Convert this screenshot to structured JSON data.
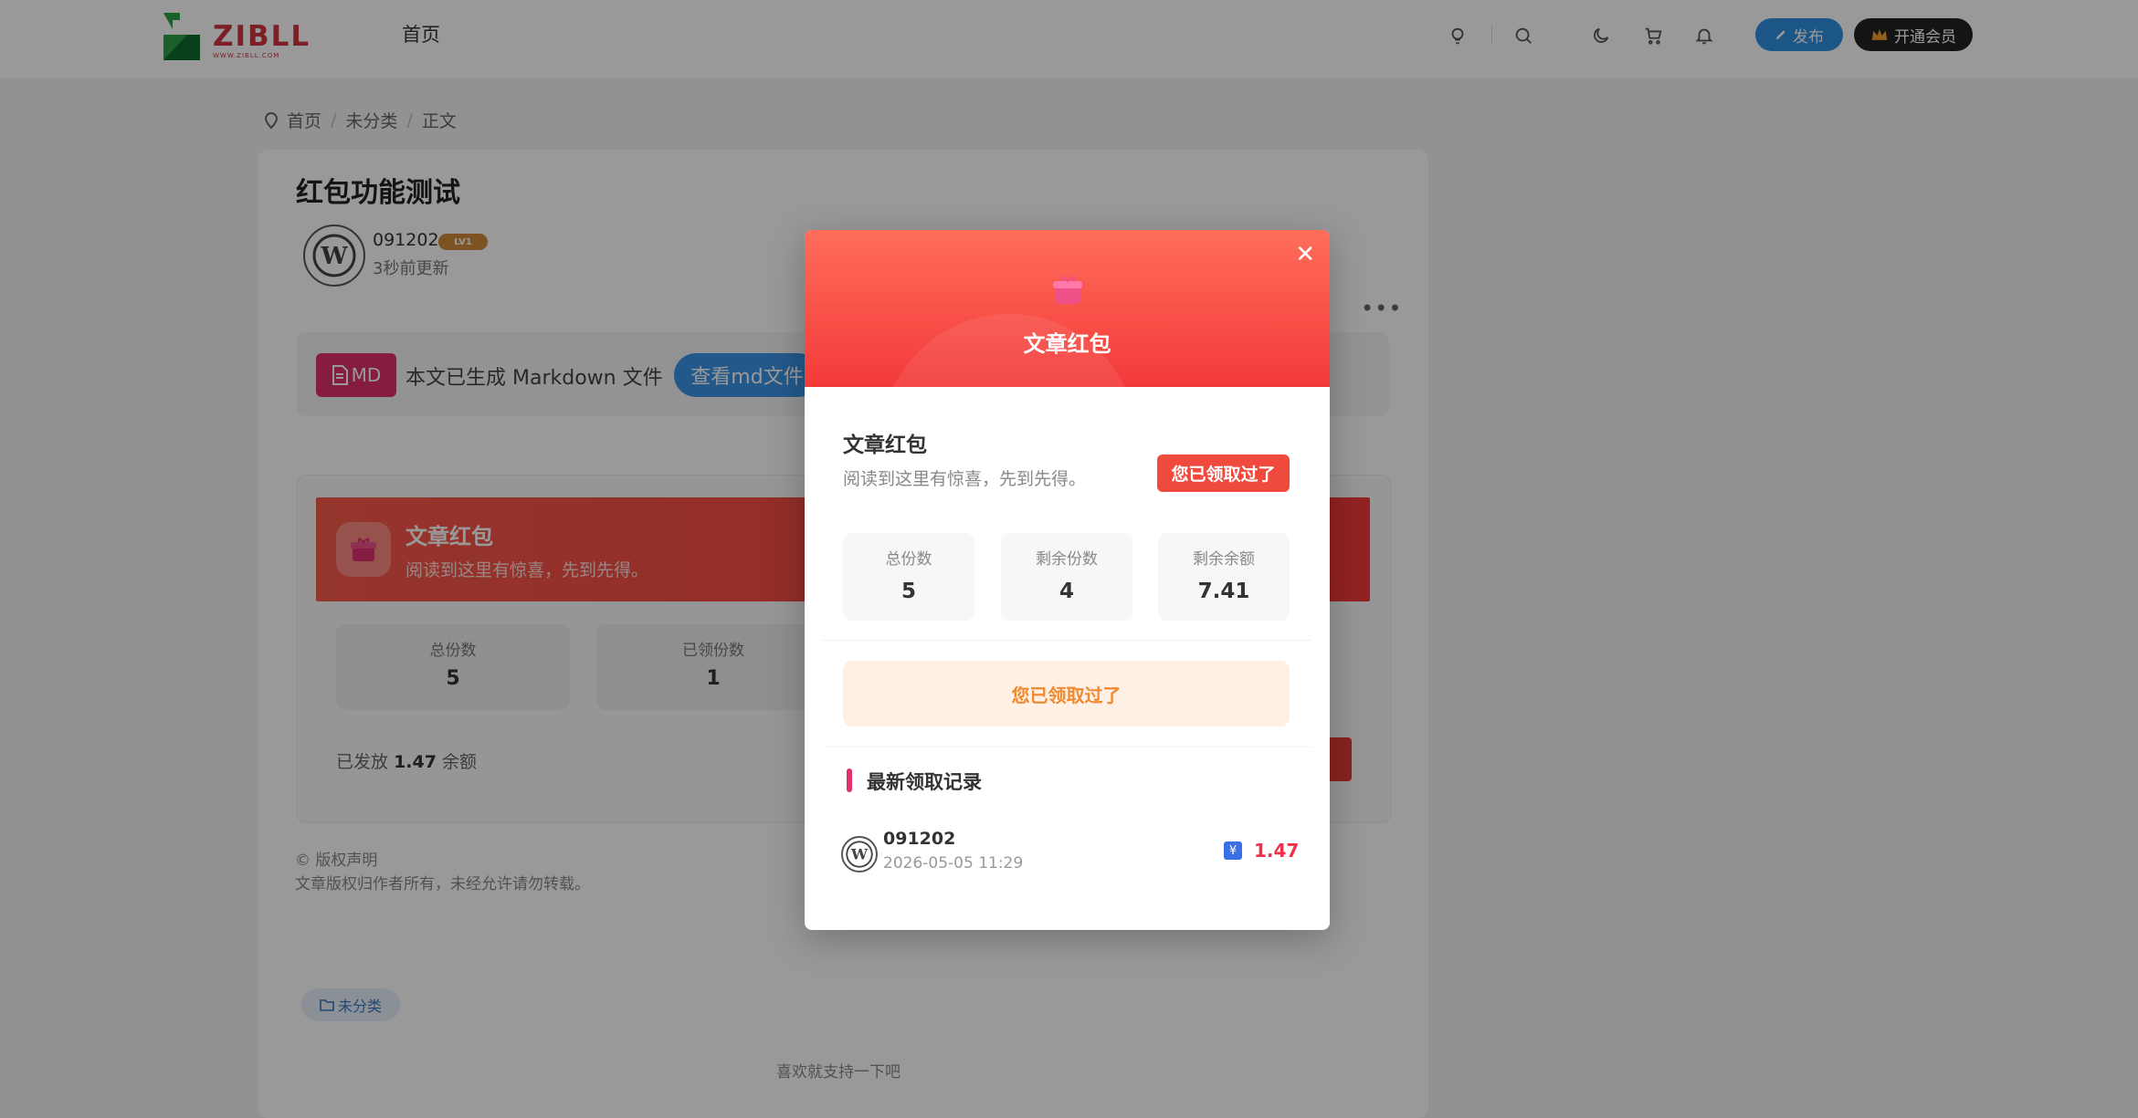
{
  "header": {
    "logo_text": "ZIBLL",
    "logo_sub": "WWW.ZIBLL.COM",
    "nav_home": "首页",
    "publish_label": "发布",
    "vip_label": "开通会员"
  },
  "breadcrumb": [
    "首页",
    "未分类",
    "正文"
  ],
  "post": {
    "title": "红包功能测试",
    "author": "091202",
    "level": "LV1",
    "updated": "3秒前更新",
    "more": "•••"
  },
  "md_notice": {
    "badge": "MD",
    "text": "本文已生成 Markdown 文件",
    "button": "查看md文件"
  },
  "redpacket_bg": {
    "title": "文章红包",
    "desc": "阅读到这里有惊喜，先到先得。",
    "stats": [
      {
        "label": "总份数",
        "value": "5"
      },
      {
        "label": "已领份数",
        "value": "1"
      }
    ],
    "sent_prefix": "已发放",
    "sent_amount": "1.47",
    "sent_suffix": "余额"
  },
  "copyright": {
    "title": "© 版权声明",
    "text": "文章版权归作者所有，未经允许请勿转载。"
  },
  "tag": "未分类",
  "like_text": "喜欢就支持一下吧",
  "modal": {
    "header_title": "文章红包",
    "title": "文章红包",
    "desc": "阅读到这里有惊喜，先到先得。",
    "claimed_badge": "您已领取过了",
    "stats": [
      {
        "label": "总份数",
        "value": "5"
      },
      {
        "label": "剩余份数",
        "value": "4"
      },
      {
        "label": "剩余余额",
        "value": "7.41"
      }
    ],
    "claimed_button": "您已领取过了",
    "records_title": "最新领取记录",
    "records": [
      {
        "name": "091202",
        "time": "2026-05-05 11:29",
        "amount": "1.47"
      }
    ]
  },
  "colors": {
    "accent_red": "#f33a3a",
    "publish_blue": "#2f8fe0",
    "md_pink": "#e0306f",
    "claimed_orange": "#f08a30"
  }
}
